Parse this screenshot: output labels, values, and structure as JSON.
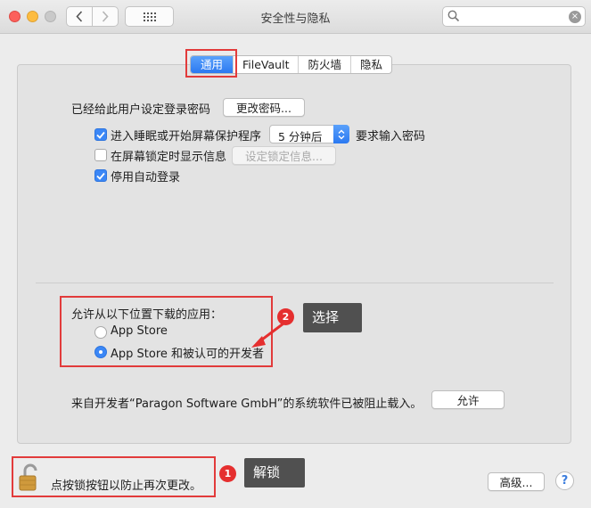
{
  "window": {
    "title": "安全性与隐私",
    "search_value": "",
    "search_clear": "×"
  },
  "tabs": [
    {
      "label": "通用",
      "active": true
    },
    {
      "label": "FileVault",
      "active": false
    },
    {
      "label": "防火墙",
      "active": false
    },
    {
      "label": "隐私",
      "active": false
    }
  ],
  "general": {
    "password_text": "已经给此用户设定登录密码",
    "change_password_button": "更改密码...",
    "require_password_label": "进入睡眠或开始屏幕保护程序",
    "require_password_checked": true,
    "require_delay_value": "5 分钟后",
    "require_password_suffix": "要求输入密码",
    "lock_message_label": "在屏幕锁定时显示信息",
    "lock_message_checked": false,
    "set_lock_message_button": "设定锁定信息...",
    "disable_autologin_label": "停用自动登录",
    "disable_autologin_checked": true
  },
  "downloads": {
    "heading": "允许从以下位置下载的应用：",
    "options": [
      {
        "label": "App Store",
        "selected": false
      },
      {
        "label": "App Store 和被认可的开发者",
        "selected": true
      }
    ]
  },
  "blocked": {
    "message": "来自开发者“Paragon Software GmbH”的系统软件已被阻止载入。",
    "allow_button": "允许"
  },
  "footer": {
    "lock_text": "点按锁按钮以防止再次更改。",
    "advanced_button": "高级...",
    "help_symbol": "?"
  },
  "annotations": {
    "step1_number": "1",
    "step1_label": "解锁",
    "step2_number": "2",
    "step2_label": "选择"
  },
  "colors": {
    "accent": "#3b87f6",
    "annotation_red": "#e23b3b",
    "callout_bg": "#505050"
  }
}
